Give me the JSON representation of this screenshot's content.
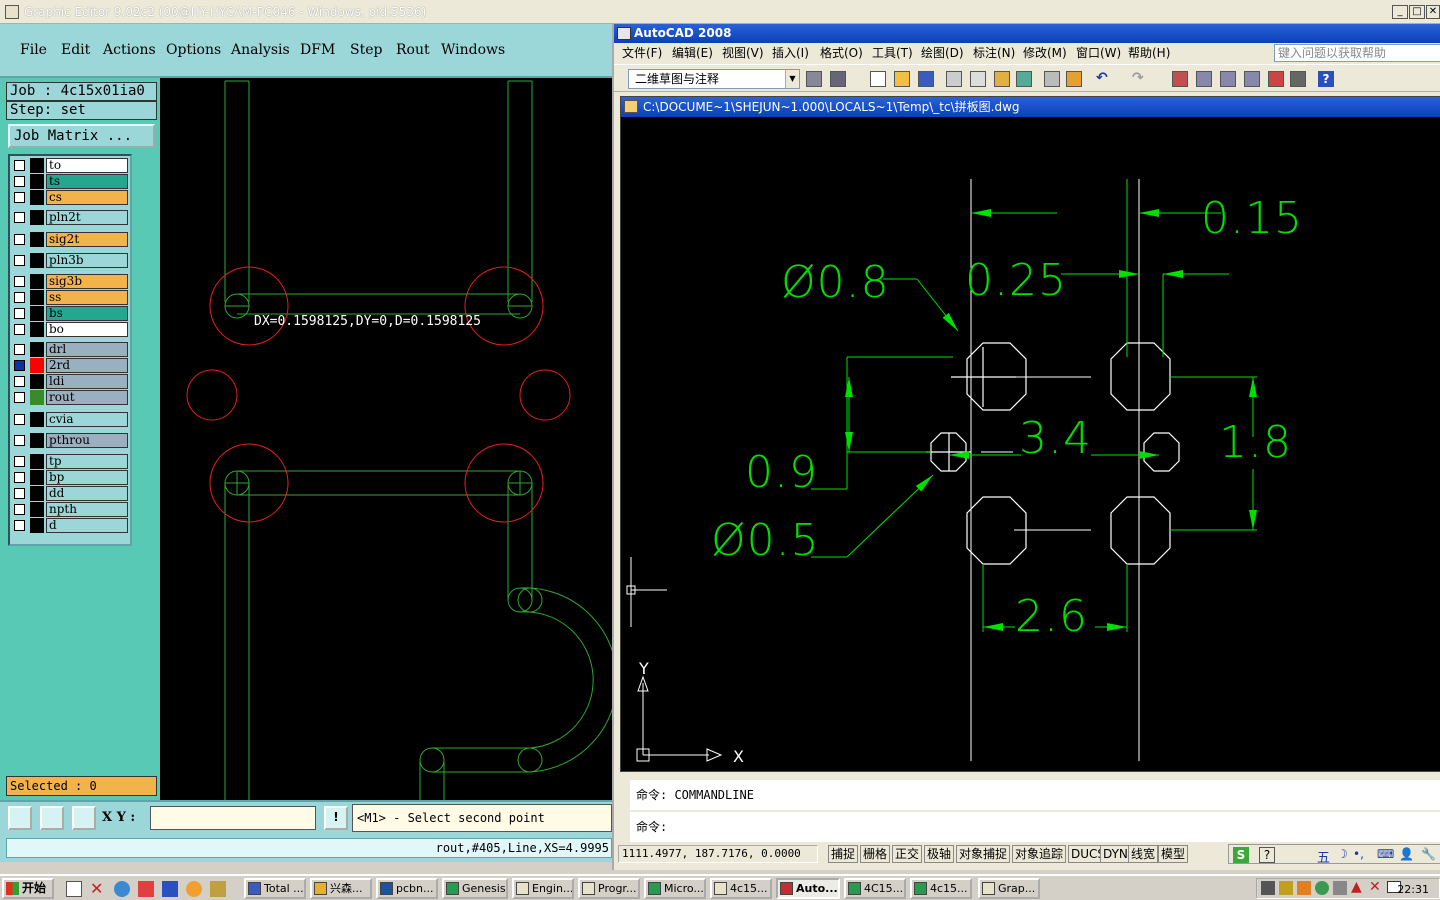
{
  "genesis": {
    "title": "Graphic Editor 9.02c2 (00@HY-HYCAM-PC046 - Windows, pid:5536)",
    "menu": [
      "File",
      "Edit",
      "Actions",
      "Options",
      "Analysis",
      "DFM",
      "Step",
      "Rout",
      "Windows"
    ],
    "job_label": "Job : 4c15x01ia0",
    "step_label": "Step: set",
    "job_matrix": "Job Matrix ...",
    "layers": [
      {
        "name": "to",
        "color": "#ffffff"
      },
      {
        "name": "ts",
        "color": "#23a88f"
      },
      {
        "name": "cs",
        "color": "#f2b24c"
      },
      {
        "name": "pln2t",
        "color": "#9bd6d9"
      },
      {
        "name": "sig2t",
        "color": "#f2b24c"
      },
      {
        "name": "pln3b",
        "color": "#9bd6d9"
      },
      {
        "name": "sig3b",
        "color": "#f2b24c"
      },
      {
        "name": "ss",
        "color": "#f2b24c"
      },
      {
        "name": "bs",
        "color": "#23a88f"
      },
      {
        "name": "bo",
        "color": "#ffffff"
      },
      {
        "name": "drl",
        "color": "#9ab0c0"
      },
      {
        "name": "2rd",
        "color": "#9ab0c0"
      },
      {
        "name": "ldi",
        "color": "#9ab0c0"
      },
      {
        "name": "rout",
        "color": "#9ab0c0"
      },
      {
        "name": "cvia",
        "color": "#9bd6d9"
      },
      {
        "name": "pthrou",
        "color": "#9ab0c0"
      },
      {
        "name": "tp",
        "color": "#9bd6d9"
      },
      {
        "name": "bp",
        "color": "#9bd6d9"
      },
      {
        "name": "dd",
        "color": "#9bd6d9"
      },
      {
        "name": "npth",
        "color": "#9bd6d9"
      },
      {
        "name": "d",
        "color": "#9bd6d9"
      }
    ],
    "selected": "Selected : 0",
    "measure": "DX=0.1598125,DY=0,D=0.1598125",
    "xy_label": "X Y :",
    "xy_value": "",
    "prompt": "<M1> - Select second point",
    "status": "rout,#405,Line,XS=4.9995"
  },
  "autocad": {
    "title": "AutoCAD 2008",
    "menu": [
      "文件(F)",
      "编辑(E)",
      "视图(V)",
      "插入(I)",
      "格式(O)",
      "工具(T)",
      "绘图(D)",
      "标注(N)",
      "修改(M)",
      "窗口(W)",
      "帮助(H)"
    ],
    "help_placeholder": "键入问题以获取帮助",
    "workspace": "二维草图与注释",
    "doc_title": "C:\\DOCUME~1\\SHEJUN~1.000\\LOCALS~1\\Temp\\_tc\\拼板图.dwg",
    "dims": {
      "d015": "0.15",
      "d025": "0.25",
      "d08": "Ø0.8",
      "d09": "0.9",
      "d05": "Ø0.5",
      "d34": "3.4",
      "d18": "1.8",
      "d26": "2.6"
    },
    "ucs_x": "X",
    "ucs_y": "Y",
    "cmd1": "命令: COMMANDLINE",
    "cmd2": "命令:",
    "coords": "1111.4977,  187.7176,  0.0000",
    "status_buttons": [
      "捕捉",
      "栅格",
      "正交",
      "极轴",
      "对象捕捉",
      "对象追踪",
      "DUCS",
      "DYN",
      "线宽",
      "模型"
    ]
  },
  "taskbar": {
    "start": "开始",
    "items": [
      "Total ...",
      "兴森...",
      "pcbn...",
      "Genesis",
      "Engin...",
      "Progr...",
      "Micro...",
      "4c15...",
      "Auto...",
      "4C15...",
      "4c15...",
      "Grap..."
    ],
    "clock": "22:31"
  }
}
